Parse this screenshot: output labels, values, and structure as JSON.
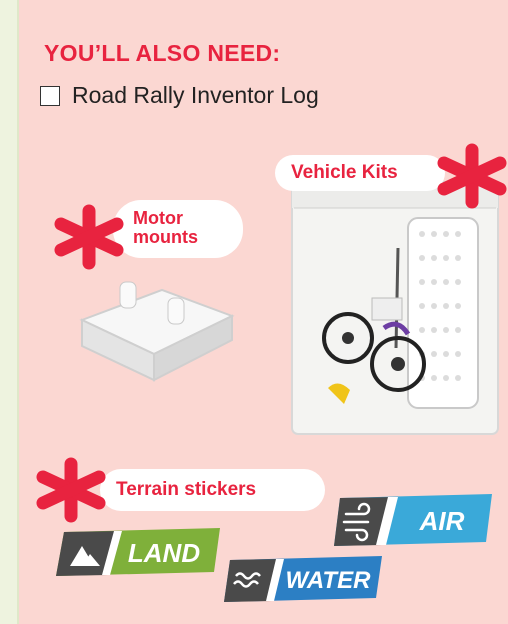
{
  "heading": "YOU’LL ALSO NEED:",
  "need_items": [
    {
      "label": "Road Rally Inventor Log",
      "checked": false
    }
  ],
  "callouts": {
    "vehicle_kits": "Vehicle Kits",
    "motor_mounts_line1": "Motor",
    "motor_mounts_line2": "mounts",
    "terrain_stickers": "Terrain stickers"
  },
  "stickers": {
    "land": {
      "label": "LAND",
      "icon": "mountain-icon",
      "color": "#7fb03a"
    },
    "water": {
      "label": "WATER",
      "icon": "waves-icon",
      "color": "#2c7fc4"
    },
    "air": {
      "label": "AIR",
      "icon": "wind-icon",
      "color": "#3aa9d9"
    }
  },
  "colors": {
    "accent": "#e8233f",
    "panel": "#fbd7d2",
    "sidebar": "#eef3df"
  }
}
